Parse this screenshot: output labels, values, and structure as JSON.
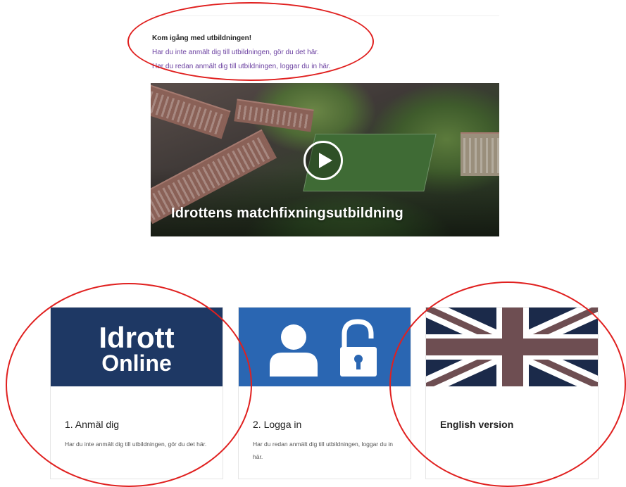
{
  "intro": {
    "heading": "Kom igång med utbildningen!",
    "link_register": "Har du inte anmält dig till utbildningen, gör du det här.",
    "link_login": "Har du redan anmält dig till utbildningen, loggar du in här."
  },
  "video": {
    "title": "Idrottens matchfixningsutbildning",
    "play_icon": "play-icon"
  },
  "cards": [
    {
      "logo_line1": "Idrott",
      "logo_line2": "Online",
      "title": "1. Anmäl dig",
      "description": "Har du inte anmält dig till utbildningen, gör du det här."
    },
    {
      "icons": [
        "user-icon",
        "unlock-icon"
      ],
      "title": "2. Logga in",
      "description": "Har du redan anmält dig till utbildningen, loggar du in här."
    },
    {
      "icon": "uk-flag-icon",
      "title": "English version"
    }
  ],
  "colors": {
    "link": "#6a3fa0",
    "idrott_blue": "#1e3864",
    "login_blue": "#2a66b2",
    "annotation_red": "#e0201f"
  }
}
